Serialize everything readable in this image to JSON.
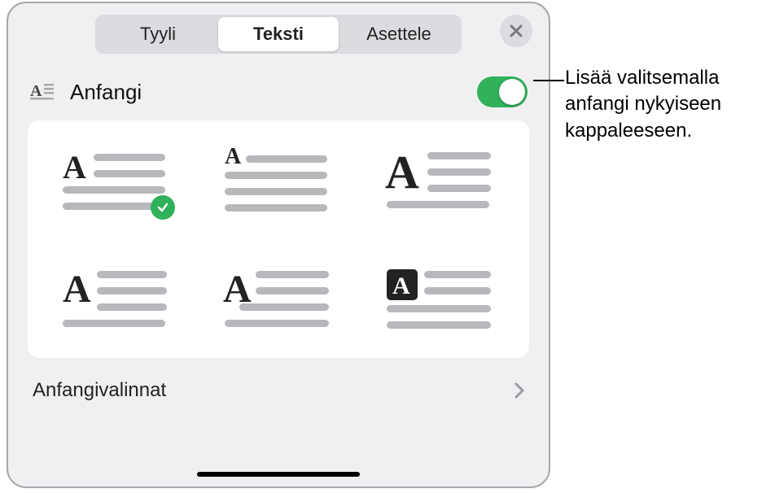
{
  "tabs": {
    "style": "Tyyli",
    "text": "Teksti",
    "arrange": "Asettele"
  },
  "section": {
    "title": "Anfangi",
    "toggle_on": true
  },
  "style_options": [
    {
      "selected": true
    },
    {
      "selected": false
    },
    {
      "selected": false
    },
    {
      "selected": false
    },
    {
      "selected": false
    },
    {
      "selected": false
    }
  ],
  "options_row": {
    "label": "Anfangivalinnat"
  },
  "callout": {
    "text": "Lisää valitsemalla anfangi nykyiseen kappaleeseen."
  }
}
